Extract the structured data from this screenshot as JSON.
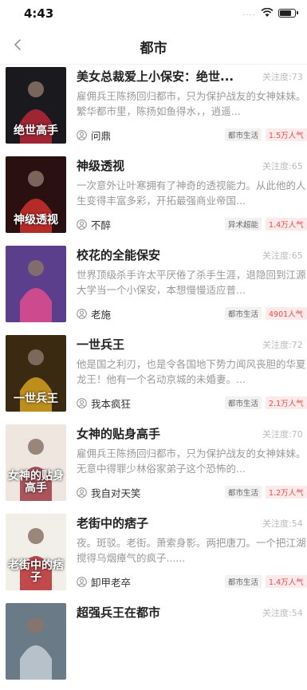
{
  "status_bar": {
    "time": "4:43",
    "signal": "....",
    "battery_level": 0.8
  },
  "nav": {
    "back_icon": "chevron-left-icon",
    "title": "都市"
  },
  "books": [
    {
      "title": "美女总裁爱上小保安：绝世...",
      "attention": "关注度:73",
      "desc": "雇佣兵王陈扬回归都市，只为保护战友的女神妹妹。繁华都市里，陈扬如鱼得水，，逍遥...",
      "author": "问鼎",
      "tag": "都市生活",
      "popularity": "1.5万人气",
      "cover_text": "绝世高手",
      "cover_bg": "#1a1a1e",
      "cover_accent": "#c0283a"
    },
    {
      "title": "神级透视",
      "attention": "关注度:65",
      "desc": "一次意外让叶寒拥有了神奇的透视能力。从此他的人生变得丰富多彩，开拓最强商业帝国...",
      "author": "不醉",
      "tag": "异术超能",
      "popularity": "1.4万人气",
      "cover_text": "神级透视",
      "cover_bg": "#2a1010",
      "cover_accent": "#d8322e"
    },
    {
      "title": "校花的全能保安",
      "attention": "关注度:65",
      "desc": "世界顶级杀手许太平厌倦了杀手生涯，退隐回到江源大学当一个小保安，本想慢慢适应普...",
      "author": "老施",
      "tag": "都市生活",
      "popularity": "4901人气",
      "cover_text": "",
      "cover_bg": "#5b3f8c",
      "cover_accent": "#e84f8f"
    },
    {
      "title": "一世兵王",
      "attention": "关注度:72",
      "desc": "他是国之利刃，也是令各国地下势力闻风丧胆的华夏龙王！他有一个名动京城的未婚妻。...",
      "author": "我本疯狂",
      "tag": "都市生活",
      "popularity": "2.1万人气",
      "cover_text": "一世兵王",
      "cover_bg": "#3b2a12",
      "cover_accent": "#e0a820"
    },
    {
      "title": "女神的贴身高手",
      "attention": "关注度:70",
      "desc": "雇佣兵王陈扬回归都市，只为保护战友的女神妹妹。无意中得罪少林俗家弟子这个恐怖的...",
      "author": "我自对天笑",
      "tag": "都市生活",
      "popularity": "1.2万人气",
      "cover_text": "女神的贴身高手",
      "cover_bg": "#efe7df",
      "cover_accent": "#9a2f3a"
    },
    {
      "title": "老街中的痞子",
      "attention": "关注度:54",
      "desc": "夜。斑驳。老街。萧索身影。两把唐刀。一个把江湖搅得乌烟瘴气的疯子......",
      "author": "卸甲老卒",
      "tag": "都市生活",
      "popularity": "1.4万人气",
      "cover_text": "老街中的痞子",
      "cover_bg": "#f2efe9",
      "cover_accent": "#b31f24"
    },
    {
      "title": "超强兵王在都市",
      "attention": "关注度:54",
      "desc": "",
      "author": "",
      "tag": "",
      "popularity": "",
      "cover_text": "",
      "cover_bg": "#6a7a86",
      "cover_accent": "#c9d3d9"
    }
  ]
}
